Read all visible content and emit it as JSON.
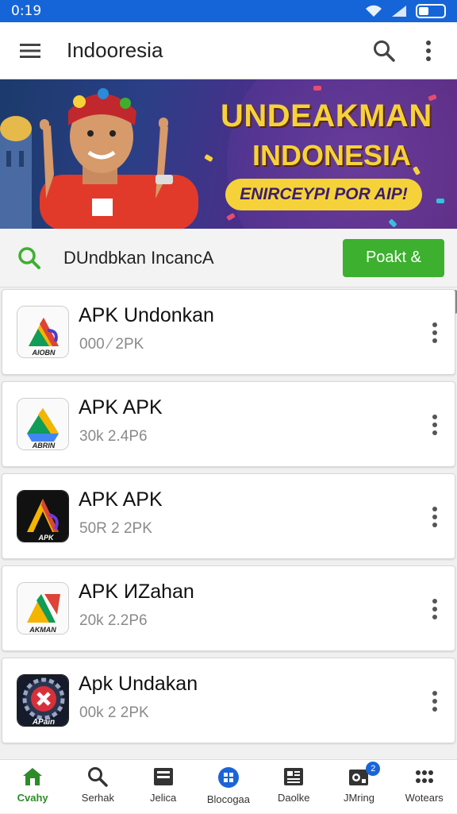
{
  "status_bar": {
    "time": "0:19"
  },
  "app_bar": {
    "title": "Indooresia"
  },
  "banner": {
    "line1": "UNDEAKMAN",
    "line2": "INDONESIA",
    "pill": "ENIRCEYPI POR AIP!"
  },
  "search": {
    "text": "DUndbkan IncancA",
    "button": "Poakt &"
  },
  "apps": [
    {
      "name": "APK Undonkan",
      "meta": "000 ⁄ 2PK",
      "icon": "google-drive-style-icon",
      "icon_label": "AIOBN"
    },
    {
      "name": "APK APK",
      "meta": "30k 2.4P6",
      "icon": "google-drive-style-icon",
      "icon_label": "ABRIN"
    },
    {
      "name": "APK APK",
      "meta": "50R 2 2PK",
      "icon": "triangle-logo-icon",
      "icon_label": "APK"
    },
    {
      "name": "APK ИZahan",
      "meta": "20k 2.2P6",
      "icon": "google-drive-style-icon",
      "icon_label": "AKMAN"
    },
    {
      "name": "Apk Undakan",
      "meta": "00k 2 2PK",
      "icon": "gear-x-icon",
      "icon_label": "APain"
    }
  ],
  "bottom_nav": [
    {
      "label": "Cvahy",
      "icon": "home-icon",
      "active": true
    },
    {
      "label": "Serhak",
      "icon": "search-icon"
    },
    {
      "label": "Jelica",
      "icon": "inbox-icon"
    },
    {
      "label": "Blocogaa",
      "icon": "apps-circle-icon"
    },
    {
      "label": "Daolke",
      "icon": "document-icon"
    },
    {
      "label": "JMring",
      "icon": "camera-badge-icon",
      "badge": "2"
    },
    {
      "label": "Wotears",
      "icon": "grid-dots-icon"
    }
  ],
  "colors": {
    "status_bar": "#1565d8",
    "accent_green": "#3db02f",
    "banner_text": "#f6d23a"
  }
}
